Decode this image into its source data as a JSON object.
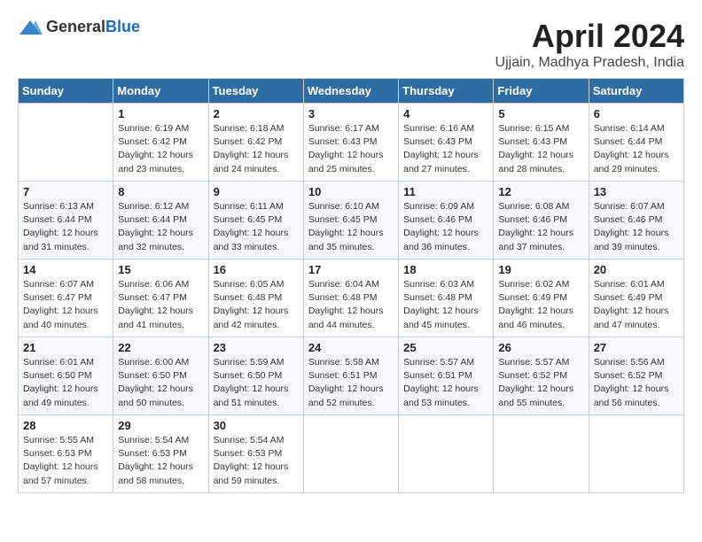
{
  "header": {
    "logo_general": "General",
    "logo_blue": "Blue",
    "title": "April 2024",
    "subtitle": "Ujjain, Madhya Pradesh, India"
  },
  "weekdays": [
    "Sunday",
    "Monday",
    "Tuesday",
    "Wednesday",
    "Thursday",
    "Friday",
    "Saturday"
  ],
  "weeks": [
    [
      {
        "day": "",
        "info": ""
      },
      {
        "day": "1",
        "info": "Sunrise: 6:19 AM\nSunset: 6:42 PM\nDaylight: 12 hours\nand 23 minutes."
      },
      {
        "day": "2",
        "info": "Sunrise: 6:18 AM\nSunset: 6:42 PM\nDaylight: 12 hours\nand 24 minutes."
      },
      {
        "day": "3",
        "info": "Sunrise: 6:17 AM\nSunset: 6:43 PM\nDaylight: 12 hours\nand 25 minutes."
      },
      {
        "day": "4",
        "info": "Sunrise: 6:16 AM\nSunset: 6:43 PM\nDaylight: 12 hours\nand 27 minutes."
      },
      {
        "day": "5",
        "info": "Sunrise: 6:15 AM\nSunset: 6:43 PM\nDaylight: 12 hours\nand 28 minutes."
      },
      {
        "day": "6",
        "info": "Sunrise: 6:14 AM\nSunset: 6:44 PM\nDaylight: 12 hours\nand 29 minutes."
      }
    ],
    [
      {
        "day": "7",
        "info": "Sunrise: 6:13 AM\nSunset: 6:44 PM\nDaylight: 12 hours\nand 31 minutes."
      },
      {
        "day": "8",
        "info": "Sunrise: 6:12 AM\nSunset: 6:44 PM\nDaylight: 12 hours\nand 32 minutes."
      },
      {
        "day": "9",
        "info": "Sunrise: 6:11 AM\nSunset: 6:45 PM\nDaylight: 12 hours\nand 33 minutes."
      },
      {
        "day": "10",
        "info": "Sunrise: 6:10 AM\nSunset: 6:45 PM\nDaylight: 12 hours\nand 35 minutes."
      },
      {
        "day": "11",
        "info": "Sunrise: 6:09 AM\nSunset: 6:46 PM\nDaylight: 12 hours\nand 36 minutes."
      },
      {
        "day": "12",
        "info": "Sunrise: 6:08 AM\nSunset: 6:46 PM\nDaylight: 12 hours\nand 37 minutes."
      },
      {
        "day": "13",
        "info": "Sunrise: 6:07 AM\nSunset: 6:46 PM\nDaylight: 12 hours\nand 39 minutes."
      }
    ],
    [
      {
        "day": "14",
        "info": "Sunrise: 6:07 AM\nSunset: 6:47 PM\nDaylight: 12 hours\nand 40 minutes."
      },
      {
        "day": "15",
        "info": "Sunrise: 6:06 AM\nSunset: 6:47 PM\nDaylight: 12 hours\nand 41 minutes."
      },
      {
        "day": "16",
        "info": "Sunrise: 6:05 AM\nSunset: 6:48 PM\nDaylight: 12 hours\nand 42 minutes."
      },
      {
        "day": "17",
        "info": "Sunrise: 6:04 AM\nSunset: 6:48 PM\nDaylight: 12 hours\nand 44 minutes."
      },
      {
        "day": "18",
        "info": "Sunrise: 6:03 AM\nSunset: 6:48 PM\nDaylight: 12 hours\nand 45 minutes."
      },
      {
        "day": "19",
        "info": "Sunrise: 6:02 AM\nSunset: 6:49 PM\nDaylight: 12 hours\nand 46 minutes."
      },
      {
        "day": "20",
        "info": "Sunrise: 6:01 AM\nSunset: 6:49 PM\nDaylight: 12 hours\nand 47 minutes."
      }
    ],
    [
      {
        "day": "21",
        "info": "Sunrise: 6:01 AM\nSunset: 6:50 PM\nDaylight: 12 hours\nand 49 minutes."
      },
      {
        "day": "22",
        "info": "Sunrise: 6:00 AM\nSunset: 6:50 PM\nDaylight: 12 hours\nand 50 minutes."
      },
      {
        "day": "23",
        "info": "Sunrise: 5:59 AM\nSunset: 6:50 PM\nDaylight: 12 hours\nand 51 minutes."
      },
      {
        "day": "24",
        "info": "Sunrise: 5:58 AM\nSunset: 6:51 PM\nDaylight: 12 hours\nand 52 minutes."
      },
      {
        "day": "25",
        "info": "Sunrise: 5:57 AM\nSunset: 6:51 PM\nDaylight: 12 hours\nand 53 minutes."
      },
      {
        "day": "26",
        "info": "Sunrise: 5:57 AM\nSunset: 6:52 PM\nDaylight: 12 hours\nand 55 minutes."
      },
      {
        "day": "27",
        "info": "Sunrise: 5:56 AM\nSunset: 6:52 PM\nDaylight: 12 hours\nand 56 minutes."
      }
    ],
    [
      {
        "day": "28",
        "info": "Sunrise: 5:55 AM\nSunset: 6:53 PM\nDaylight: 12 hours\nand 57 minutes."
      },
      {
        "day": "29",
        "info": "Sunrise: 5:54 AM\nSunset: 6:53 PM\nDaylight: 12 hours\nand 58 minutes."
      },
      {
        "day": "30",
        "info": "Sunrise: 5:54 AM\nSunset: 6:53 PM\nDaylight: 12 hours\nand 59 minutes."
      },
      {
        "day": "",
        "info": ""
      },
      {
        "day": "",
        "info": ""
      },
      {
        "day": "",
        "info": ""
      },
      {
        "day": "",
        "info": ""
      }
    ]
  ]
}
